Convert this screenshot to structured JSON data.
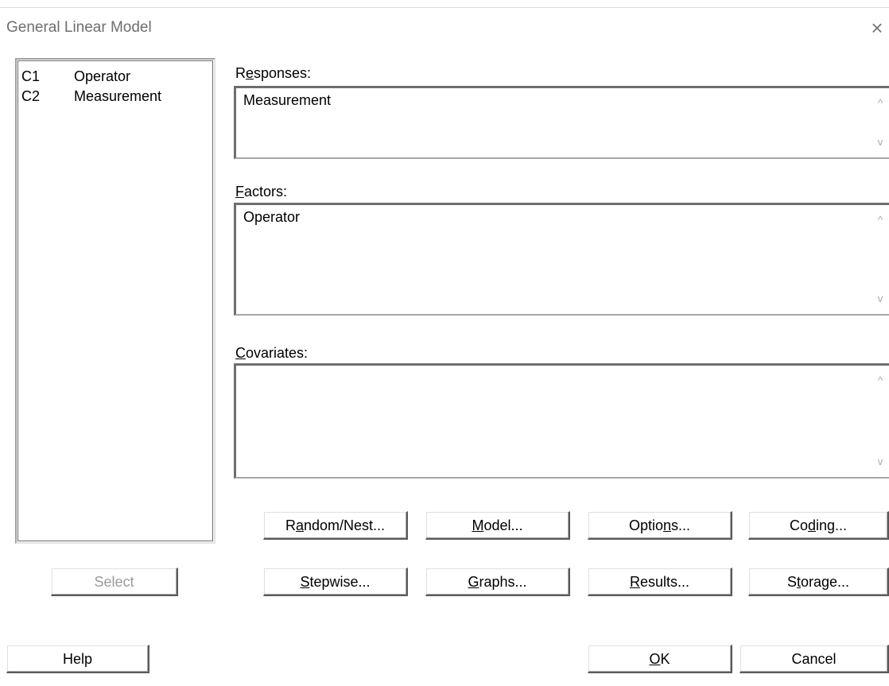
{
  "window": {
    "title": "General Linear Model",
    "close_glyph": "×"
  },
  "variables": [
    {
      "col": "C1",
      "name": "Operator"
    },
    {
      "col": "C2",
      "name": "Measurement"
    }
  ],
  "fields": {
    "responses": {
      "label_pre": "R",
      "label_key": "e",
      "label_post": "sponses:",
      "value": "Measurement"
    },
    "factors": {
      "label_pre": "",
      "label_key": "F",
      "label_post": "actors:",
      "value": "Operator"
    },
    "covariates": {
      "label_pre": "",
      "label_key": "C",
      "label_post": "ovariates:",
      "value": ""
    }
  },
  "buttons": {
    "select": {
      "label": "Select"
    },
    "random_nest": {
      "pre": "R",
      "key": "a",
      "post": "ndom/Nest..."
    },
    "model": {
      "pre": "",
      "key": "M",
      "post": "odel..."
    },
    "options": {
      "pre": "Optio",
      "key": "n",
      "post": "s..."
    },
    "coding": {
      "pre": "Co",
      "key": "d",
      "post": "ing..."
    },
    "stepwise": {
      "pre": "",
      "key": "S",
      "post": "tepwise..."
    },
    "graphs": {
      "pre": "",
      "key": "G",
      "post": "raphs..."
    },
    "results": {
      "pre": "",
      "key": "R",
      "post": "esults..."
    },
    "storage": {
      "pre": "S",
      "key": "t",
      "post": "orage..."
    },
    "help": {
      "label": "Help"
    },
    "ok": {
      "pre": "",
      "key": "O",
      "post": "K"
    },
    "cancel": {
      "label": "Cancel"
    }
  },
  "scroll_glyphs": {
    "up": "^",
    "down": "v"
  },
  "colors": {
    "title_text": "#6e6e6e",
    "disabled_text": "#9a9a9a",
    "border_dark": "#6e6e6e"
  }
}
